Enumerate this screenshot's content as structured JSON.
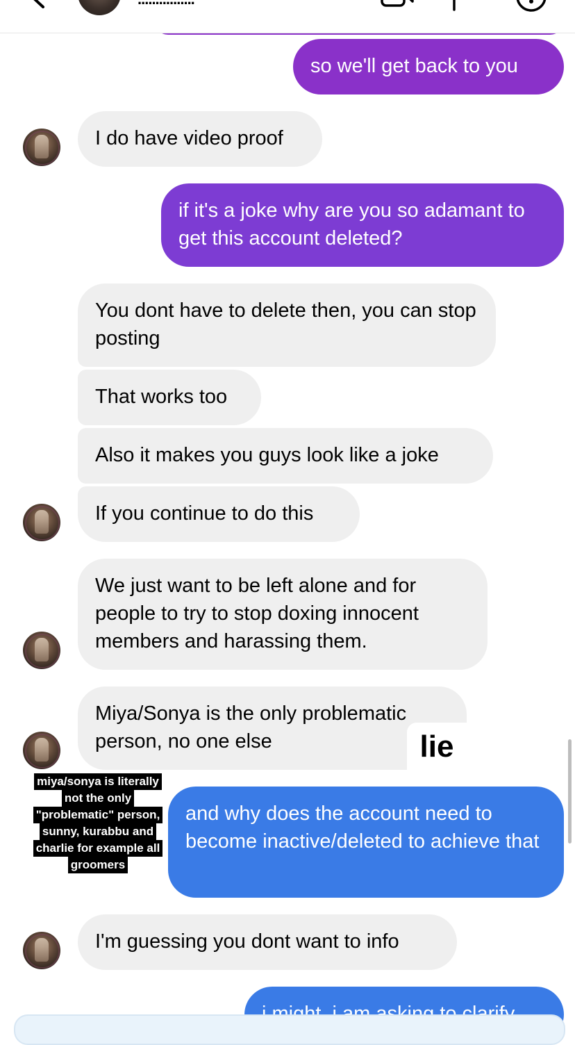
{
  "header": {
    "contact_name": "................"
  },
  "messages": [
    {
      "text": "so we'll get back to you"
    },
    {
      "text": "I do have video proof"
    },
    {
      "text": "if it's a joke why are you so adamant to get this account deleted?"
    },
    {
      "text": "You dont have to delete then, you can stop posting"
    },
    {
      "text": "That works too"
    },
    {
      "text": "Also it makes you guys look like a joke"
    },
    {
      "text": "If you continue to do this"
    },
    {
      "text": "We just want to be left alone and for people to try to stop doxing innocent members and harassing them."
    },
    {
      "text": "Miya/Sonya is the only problematic person, no one else"
    },
    {
      "text": "and why does the account need to become inactive/deleted to achieve that"
    },
    {
      "text": "I'm guessing you dont want to info"
    },
    {
      "text": "i might, i am asking to clarify"
    }
  ],
  "annotations": {
    "lie": "lie",
    "note_lines": [
      "miya/sonya is literally",
      "not the only",
      "\"problematic\" person,",
      "sunny, kurabbu and",
      "charlie for example all",
      "groomers"
    ]
  },
  "colors": {
    "outgoing_purple": "#8a31c9",
    "outgoing_purple_2": "#7d3cd3",
    "outgoing_blue": "#3a7be6",
    "incoming_gray": "#efefef"
  }
}
